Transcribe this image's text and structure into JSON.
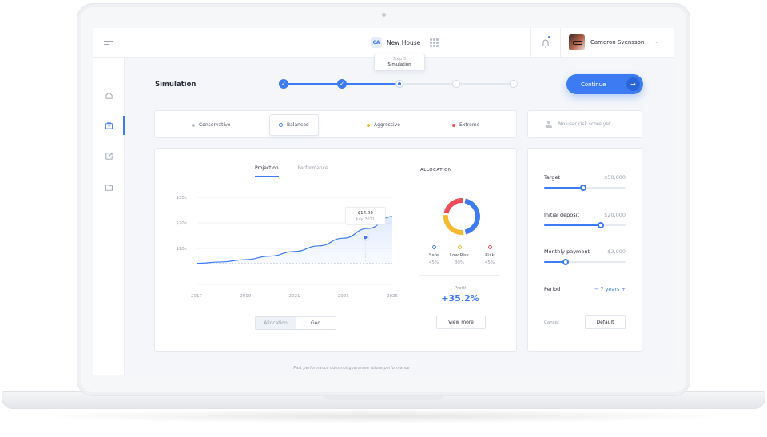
{
  "header": {
    "project_badge": "CA",
    "project_name": "New House",
    "user_name": "Cameron Svensson"
  },
  "page": {
    "title": "Simulation",
    "step_tooltip_step": "Step 3",
    "step_tooltip_name": "Simulation",
    "steps_total": 5,
    "steps_done": 2,
    "step_current": 3,
    "continue_label": "Continue"
  },
  "risk_options": [
    {
      "label": "Conservative",
      "color": "#b9bfc9",
      "active": false
    },
    {
      "label": "Balanced",
      "color": "#3d7bf2",
      "active": true
    },
    {
      "label": "Aggressive",
      "color": "#f5b82e",
      "active": false
    },
    {
      "label": "Extreme",
      "color": "#ef4f5b",
      "active": false
    }
  ],
  "no_risk_text": "No user risk score yet",
  "chart_tabs": [
    "Projection",
    "Performance"
  ],
  "chart_data": {
    "type": "area",
    "x_ticks": [
      "2017",
      "2019",
      "2021",
      "2023",
      "2025"
    ],
    "y_ticks": [
      "$30k",
      "$20k",
      "$10k"
    ],
    "ylim": [
      0,
      30000
    ],
    "xlim": [
      2017,
      2025
    ],
    "x": [
      2017,
      2018,
      2019,
      2020,
      2021,
      2022,
      2023,
      2024,
      2025
    ],
    "y": [
      4200,
      4700,
      5600,
      7000,
      8800,
      11000,
      14000,
      17800,
      22500
    ],
    "highlight": {
      "x": 2023.9,
      "y": 14300,
      "value": "$14.00",
      "date": "July 2021"
    },
    "baseline": 4200,
    "color": "#3d7bf2",
    "grid": true
  },
  "chart_segment": [
    "Allocation",
    "Geo"
  ],
  "allocation": {
    "title": "ALLOCATION",
    "slices": [
      {
        "label": "Safe",
        "percent": "45%",
        "value": 45,
        "color": "#3d7bf2"
      },
      {
        "label": "Low Risk",
        "percent": "30%",
        "value": 30,
        "color": "#f5b82e"
      },
      {
        "label": "Risk",
        "percent": "45%",
        "value": 25,
        "color": "#ef4f5b"
      }
    ],
    "profit_label": "Profit",
    "profit_value": "+35.2%",
    "view_more": "View more"
  },
  "settings": {
    "target": {
      "label": "Target",
      "value": "$50,000",
      "fraction": 0.48
    },
    "initial": {
      "label": "Initial deposit",
      "value": "$20,000",
      "fraction": 0.7
    },
    "monthly": {
      "label": "Monthly payment",
      "value": "$2,000",
      "fraction": 0.26
    },
    "period": {
      "label": "Period",
      "value": "− 7 years +"
    },
    "cancel": "Cancel",
    "default": "Default"
  },
  "disclaimer": "Past performance does not guarantee future performance"
}
